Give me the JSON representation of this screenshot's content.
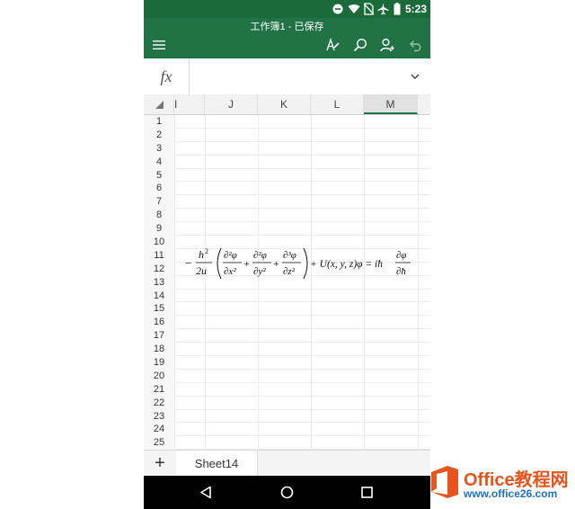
{
  "status_bar": {
    "time": "5:23",
    "icons": [
      "minus-circle-icon",
      "wifi-icon",
      "no-sim-icon",
      "airplane-icon",
      "battery-icon"
    ]
  },
  "app_bar": {
    "title": "工作簿1 - 已保存",
    "icons": [
      "menu-icon",
      "pen-icon",
      "search-icon",
      "share-person-icon",
      "undo-icon"
    ]
  },
  "formula_bar": {
    "fx_label": "fx",
    "value": ""
  },
  "columns": [
    "I",
    "J",
    "K",
    "L",
    "M"
  ],
  "selected_column": "M",
  "rows": [
    "1",
    "2",
    "3",
    "4",
    "5",
    "6",
    "7",
    "8",
    "9",
    "10",
    "11",
    "12",
    "13",
    "14",
    "15",
    "16",
    "17",
    "18",
    "19",
    "20",
    "21",
    "22",
    "23",
    "24",
    "25"
  ],
  "equation": {
    "h": "h",
    "two_u": "2u",
    "d2phi": "∂²φ",
    "dx2": "∂x²",
    "dy2": "∂y²",
    "d3phi": "∂³φ",
    "dz2": "∂z²",
    "potential": "+ U(x, y, z)φ = iħ",
    "dphi": "∂φ",
    "dhbar": "∂ħ"
  },
  "sheet_bar": {
    "add_label": "+",
    "sheet_name": "Sheet14"
  },
  "watermark": {
    "brand": "Office教程网",
    "url": "www.office26.com"
  },
  "colors": {
    "excel_green": "#217346",
    "status_green": "#1b6b3a",
    "watermark_orange": "#e8541c",
    "watermark_blue": "#1a73c9"
  }
}
